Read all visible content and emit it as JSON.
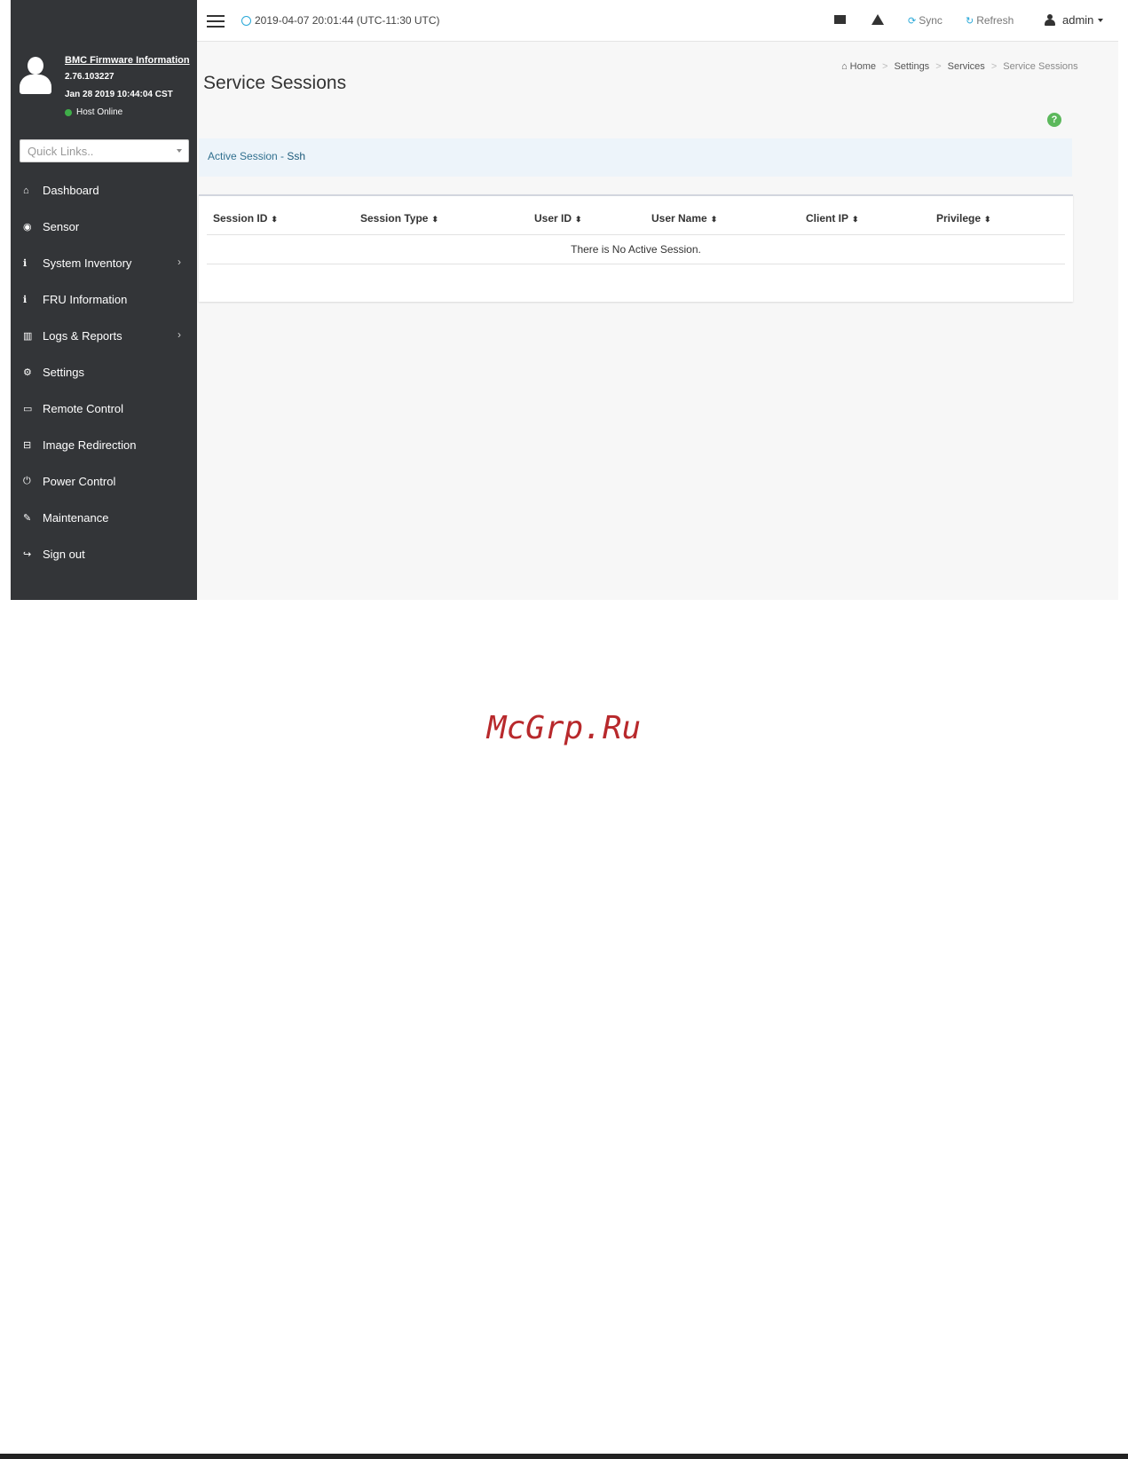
{
  "sidebar": {
    "fw_title": "BMC Firmware Information",
    "fw_version": "2.76.103227",
    "fw_date": "Jan 28 2019 10:44:04 CST",
    "host_status": "Host Online",
    "host_status_color": "#3fae49",
    "quick_links_placeholder": "Quick Links..",
    "items": [
      {
        "label": "Dashboard",
        "icon": "home-icon",
        "glyph": "⌂"
      },
      {
        "label": "Sensor",
        "icon": "tachometer-icon",
        "glyph": "◉"
      },
      {
        "label": "System Inventory",
        "icon": "info-icon",
        "glyph": "ℹ",
        "chevron": "›"
      },
      {
        "label": "FRU Information",
        "icon": "info-icon",
        "glyph": "ℹ"
      },
      {
        "label": "Logs & Reports",
        "icon": "bar-chart-icon",
        "glyph": "▥",
        "chevron": "›"
      },
      {
        "label": "Settings",
        "icon": "gear-icon",
        "glyph": "⚙"
      },
      {
        "label": "Remote Control",
        "icon": "monitor-icon",
        "glyph": "▭"
      },
      {
        "label": "Image Redirection",
        "icon": "drive-icon",
        "glyph": "⊟"
      },
      {
        "label": "Power Control",
        "icon": "power-icon",
        "glyph": "⏻"
      },
      {
        "label": "Maintenance",
        "icon": "wrench-icon",
        "glyph": "✎"
      },
      {
        "label": "Sign out",
        "icon": "sign-out-icon",
        "glyph": "↪"
      }
    ]
  },
  "topbar": {
    "datetime": "2019-04-07 20:01:44 (UTC-11:30 UTC)",
    "sync_label": "Sync",
    "refresh_label": "Refresh",
    "user_label": "admin",
    "accent_color": "#29a8d8"
  },
  "page": {
    "title": "Service Sessions",
    "breadcrumb": [
      "Home",
      "Settings",
      "Services",
      "Service Sessions"
    ],
    "breadcrumb_sep": ">",
    "help_glyph": "?",
    "alert_prefix": "Active Session - ",
    "alert_session": "Ssh",
    "table": {
      "headers": [
        "Session ID",
        "Session Type",
        "User ID",
        "User Name",
        "Client IP",
        "Privilege"
      ],
      "sort_glyph": "⬍",
      "empty_message": "There is No Active Session."
    }
  },
  "watermark": "McGrp.Ru"
}
